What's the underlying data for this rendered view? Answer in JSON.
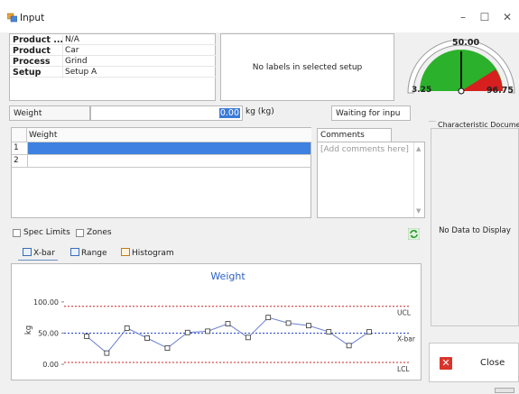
{
  "window": {
    "title": "Input",
    "minimize": "–",
    "maximize": "☐",
    "close": "✕"
  },
  "info": {
    "rows": [
      {
        "label": "Product ...",
        "value": "N/A"
      },
      {
        "label": "Product",
        "value": "Car"
      },
      {
        "label": "Process",
        "value": "Grind"
      },
      {
        "label": "Setup",
        "value": "Setup A"
      }
    ]
  },
  "labels_panel": {
    "text": "No labels in selected setup"
  },
  "input": {
    "label": "Weight",
    "value": "0.00",
    "unit": "kg (kg)",
    "status": "Waiting for inpu"
  },
  "grid": {
    "column": "Weight",
    "rows": [
      "1",
      "2"
    ]
  },
  "comments": {
    "tab": "Comments",
    "placeholder": "[Add comments here]"
  },
  "options": {
    "spec_limits": "Spec Limits",
    "zones": "Zones"
  },
  "tabs": [
    {
      "label": "X-bar"
    },
    {
      "label": "Range"
    },
    {
      "label": "Histogram"
    }
  ],
  "chart_data": {
    "type": "line",
    "title": "Weight",
    "ylabel": "kg",
    "yticks": [
      "100.00",
      "50.00",
      "0.00"
    ],
    "ylim": [
      -10,
      120
    ],
    "x": [
      1,
      2,
      3,
      4,
      5,
      6,
      7,
      8,
      9,
      10,
      11,
      12,
      13,
      14,
      15
    ],
    "series": [
      {
        "values": [
          45,
          18,
          58,
          42,
          26,
          51,
          53,
          65,
          43,
          75,
          66,
          62,
          52,
          30,
          52
        ]
      }
    ],
    "reference_lines": [
      {
        "label": "UCL",
        "value": 93,
        "color": "#cc2222"
      },
      {
        "label": "X-bar",
        "value": 50,
        "color": "#2244cc"
      },
      {
        "label": "LCL",
        "value": 3,
        "color": "#cc2222"
      }
    ],
    "colors": {
      "line": "#6a7fd0",
      "title": "#2a62c8"
    }
  },
  "gauge": {
    "value": "50.00",
    "min": "3.25",
    "max": "96.75",
    "colors": {
      "ok": "#2bb12b",
      "warn": "#d81f1f",
      "needle": "#111111"
    }
  },
  "documents": {
    "title": "Characteristic Documents",
    "empty": "No Data to Display"
  },
  "close_button": {
    "label": "Close"
  }
}
